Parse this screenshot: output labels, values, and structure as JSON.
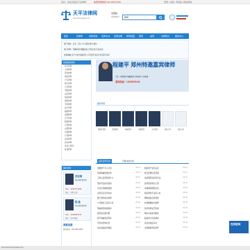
{
  "topbar": {
    "welcome": "您好，欢迎光临天平法律网",
    "phone": "免费咨询热线 400-0000-0000",
    "links": "登录 | 注册 | 手机版 | 网站导航"
  },
  "logo": {
    "name": "天平法律网",
    "url": "www.tianpinglaw.com"
  },
  "region": {
    "label": "全国站",
    "sub": "[切换城市]"
  },
  "search": {
    "selected": "律师"
  },
  "nav": [
    "首页",
    "找律师",
    "法律咨询",
    "法律文书",
    "法律法规",
    "律师加盟",
    "律所",
    "案例",
    "法律知识",
    "服务中心"
  ],
  "subnav": [
    "热门城市：北京 上海 广州 深圳 杭州 郑州",
    "热门律师：刑事辩护 婚姻家庭 合同纠纷 劳动争议",
    "交通事故 房产纠纷 债权债务 公司法务 知识产权 医疗纠纷"
  ],
  "sidebar": {
    "title": "按地区找律师",
    "items": [
      "北京律师",
      "上海律师",
      "天津律师",
      "重庆律师",
      "广东律师",
      "浙江律师",
      "江苏律师",
      "河南律师",
      "山东律师",
      "湖北律师",
      "湖南律师",
      "河北律师",
      "四川律师",
      "福建律师",
      "安徽律师",
      "辽宁律师",
      "陕西律师",
      "江西律师",
      "山西律师",
      "吉林律师",
      "广西律师",
      "云南律师",
      "贵州律师",
      "黑龙江律师",
      "甘肃律师"
    ]
  },
  "banner": {
    "title": "程建平 郑州特邀嘉宾律师",
    "desc": "专长：刑事辩护 婚姻家庭 合同纠纷 人身损害",
    "tel": "咨询电话：13938876226"
  },
  "recommend": {
    "title": "推荐律师"
  },
  "lawyers": [
    {
      "name": "程建平律师",
      "blank": false
    },
    {
      "name": "付国律师",
      "blank": false
    },
    {
      "name": "杨成律师",
      "blank": false
    },
    {
      "name": "刘强律师",
      "blank": false
    },
    {
      "name": "王东律师",
      "blank": false
    },
    {
      "name": "虚位以待",
      "blank": true
    },
    {
      "name": "虚位以待",
      "blank": true
    }
  ],
  "tabs": [
    "最新法律咨询",
    "已解决的咨询"
  ],
  "news_left": [
    {
      "t": "离婚财产怎么分割",
      "d": "05-07"
    },
    {
      "t": "交通事故赔偿标准",
      "d": "05-07"
    },
    {
      "t": "工伤认定流程是什么",
      "d": "05-07"
    },
    {
      "t": "借款不还如何起诉",
      "d": "05-06"
    },
    {
      "t": "劳动合同解除赔偿",
      "d": "05-06"
    },
    {
      "t": "房屋买卖合同纠纷",
      "d": "05-06"
    },
    {
      "t": "遗产继承如何办理",
      "d": "05-06"
    },
    {
      "t": "公司拖欠工资怎么办",
      "d": "05-05"
    },
    {
      "t": "刑事案件取保候审",
      "d": "05-05"
    },
    {
      "t": "抚养权归属问题",
      "d": "05-05"
    },
    {
      "t": "医疗事故鉴定程序",
      "d": "05-05"
    },
    {
      "t": "合同违约金标准",
      "d": "05-04"
    },
    {
      "t": "商标侵权如何维权",
      "d": "05-04"
    }
  ],
  "news_right": [
    {
      "t": "婚前财产如何认定",
      "d": "05-07"
    },
    {
      "t": "拆迁补偿标准问题",
      "d": "05-07"
    },
    {
      "t": "试用期辞退是否合法",
      "d": "05-07"
    },
    {
      "t": "民间借贷利息上限",
      "d": "05-06"
    },
    {
      "t": "车辆保险理赔纠纷",
      "d": "05-06"
    },
    {
      "t": "租房押金不退怎么办",
      "d": "05-06"
    },
    {
      "t": "网购维权法律途径",
      "d": "05-06"
    },
    {
      "t": "社保断缴如何处理",
      "d": "05-05"
    },
    {
      "t": "债务转移是否有效",
      "d": "05-05"
    },
    {
      "t": "物业纠纷如何解决",
      "d": "05-05"
    },
    {
      "t": "股权转让注意事项",
      "d": "05-05"
    },
    {
      "t": "诉讼时效是多久",
      "d": "05-04"
    },
    {
      "t": "法律援助申请条件",
      "d": "05-04"
    }
  ],
  "promo": {
    "title": "推荐律师",
    "cards": [
      {
        "name": "白宏增",
        "desc": "郑州律师事务所",
        "tel": "TEL：13937971938",
        "note": "擅长：刑事 民事"
      },
      {
        "name": "程 磊",
        "desc": "郑州律师事务所",
        "tel": "TEL：13939897678",
        "note": "擅长：合同 婚姻"
      }
    ],
    "join": "我要加盟",
    "join_note": "咨询电话：400-0000-0000"
  },
  "float_badge": "在线咨询",
  "bottom": "http://www.tianpinglaw.com/"
}
